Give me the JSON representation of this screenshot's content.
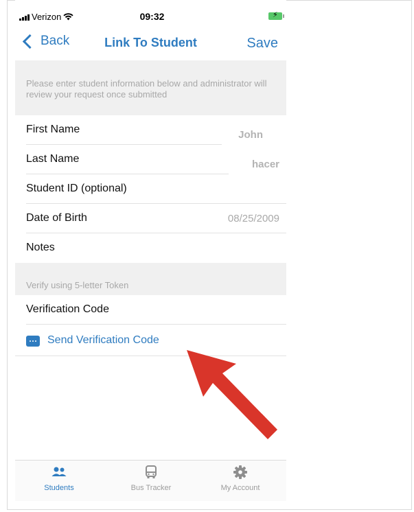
{
  "status_bar": {
    "carrier": "Verizon",
    "time": "09:32"
  },
  "nav": {
    "back_label": "Back",
    "title": "Link To Student",
    "save_label": "Save"
  },
  "info_section": {
    "header_text": "Please enter student information below and administrator will review your request once submitted",
    "fields": [
      {
        "label": "First Name",
        "value": "John"
      },
      {
        "label": "Last Name",
        "value": "hacer"
      },
      {
        "label": "Student ID (optional)",
        "value": ""
      },
      {
        "label": "Date of Birth",
        "value": "08/25/2009"
      },
      {
        "label": "Notes",
        "value": ""
      }
    ]
  },
  "verify_section": {
    "header_text": "Verify using 5-letter Token",
    "code_label": "Verification Code",
    "send_label": "Send Verification Code"
  },
  "tab_bar": {
    "tabs": [
      {
        "label": "Students",
        "icon": "students-icon",
        "active": true
      },
      {
        "label": "Bus Tracker",
        "icon": "bus-icon",
        "active": false
      },
      {
        "label": "My Account",
        "icon": "gear-icon",
        "active": false
      }
    ]
  },
  "colors": {
    "accent": "#2f7cc0",
    "section_bg": "#f0f0f0",
    "arrow": "#d9352a",
    "battery": "#57c769"
  }
}
